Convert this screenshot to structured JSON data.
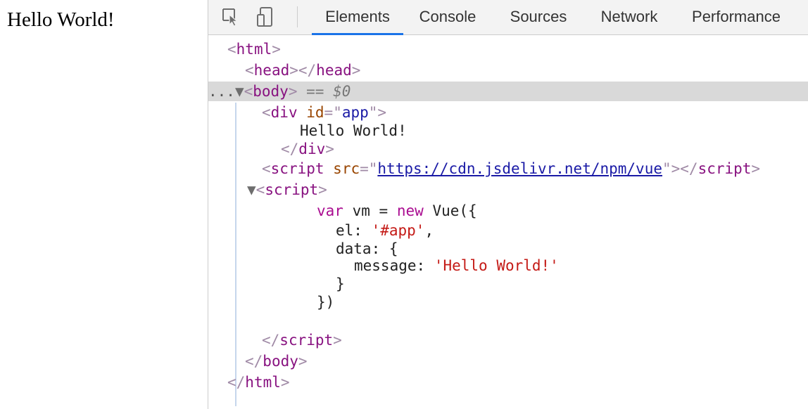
{
  "page": {
    "content_text": "Hello World!"
  },
  "toolbar": {
    "icons": [
      "select-element-icon",
      "device-toolbar-icon"
    ],
    "tabs": [
      {
        "label": "Elements",
        "active": true
      },
      {
        "label": "Console",
        "active": false
      },
      {
        "label": "Sources",
        "active": false
      },
      {
        "label": "Network",
        "active": false
      },
      {
        "label": "Performance",
        "active": false
      }
    ]
  },
  "dom": {
    "html_tag": "html",
    "head_tag": "head",
    "body_tag": "body",
    "body_dots": "...",
    "body_selected_marker": "== $0",
    "div_tag": "div",
    "div_attr_name": "id",
    "div_attr_value": "app",
    "div_text": "Hello World!",
    "script_tag": "script",
    "script_attr_name": "src",
    "script_src": "https://cdn.jsdelivr.net/npm/vue",
    "code": {
      "line1_kw1": "var",
      "line1_ident": "vm",
      "line1_eq": "=",
      "line1_kw2": "new",
      "line1_rest": "Vue({",
      "line2_key": "el:",
      "line2_val": "'#app'",
      "line2_comma": ",",
      "line3": "data: {",
      "line4_key": "message:",
      "line4_val": "'Hello World!'",
      "line5": "}",
      "line6": "})"
    }
  },
  "colors": {
    "active_tab_underline": "#1a73e8",
    "selected_row": "#d9d9d9",
    "tag": "#881280",
    "attr_name": "#994500",
    "attr_value": "#1a1aa6",
    "string": "#c41a16"
  }
}
